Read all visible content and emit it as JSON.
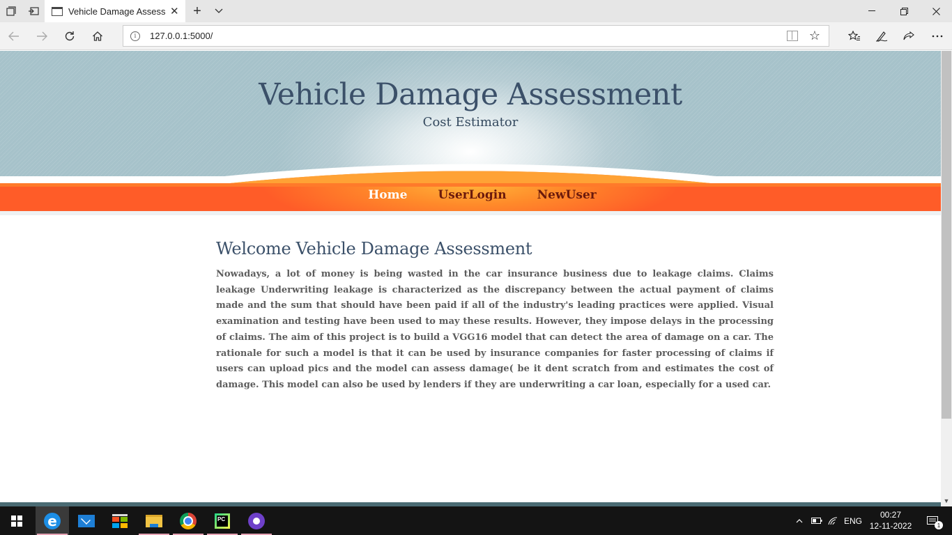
{
  "browser": {
    "tab_title": "Vehicle Damage Assessment",
    "url": "127.0.0.1:5000/",
    "icons": {
      "tab_preview": "tab-preview-icon",
      "set_aside": "set-aside-tabs-icon",
      "back": "back-arrow-icon",
      "forward": "forward-arrow-icon",
      "refresh": "refresh-icon",
      "home": "home-icon",
      "info": "site-info-icon",
      "reading_view": "reading-view-icon",
      "favorite": "star-icon",
      "favorites_hub": "favorites-hub-icon",
      "notes": "pen-icon",
      "share": "share-icon",
      "more": "more-icon"
    }
  },
  "site": {
    "title": "Vehicle Damage Assessment",
    "subtitle": "Cost Estimator",
    "nav": {
      "home": "Home",
      "userlogin": "UserLogin",
      "newuser": "NewUser"
    },
    "heading": "Welcome Vehicle Damage Assessment",
    "body": "Nowadays, a lot of money is being wasted in the car insurance business due to leakage claims. Claims leakage Underwriting leakage is characterized as the discrepancy between the actual payment of claims made and the sum that should have been paid if all of the industry's leading practices were applied. Visual examination and testing have been used to may these results. However, they impose delays in the processing of claims. The aim of this project is to build a VGG16 model that can detect the area of damage on a car. The rationale for such a model is that it can be used by insurance companies for faster processing of claims if users can upload pics and the model can assess damage( be it dent scratch from and estimates the cost of damage. This model can also be used by lenders if they are underwriting a car loan, especially for a used car."
  },
  "colors": {
    "header_bg": "#a6c2ca",
    "title": "#3b5069",
    "menu_orange": "#ff5c28",
    "menu_active": "#ffffff",
    "menu_link": "#6b1a0c",
    "body_text": "#5d5d5d"
  },
  "taskbar": {
    "apps": [
      "start-icon",
      "edge-icon",
      "mail-icon",
      "store-icon",
      "file-explorer-icon",
      "chrome-icon",
      "pycharm-icon",
      "github-desktop-icon"
    ],
    "pycharm_label": "PC",
    "language": "ENG",
    "time": "00:27",
    "date": "12-11-2022",
    "notifications": "1"
  }
}
